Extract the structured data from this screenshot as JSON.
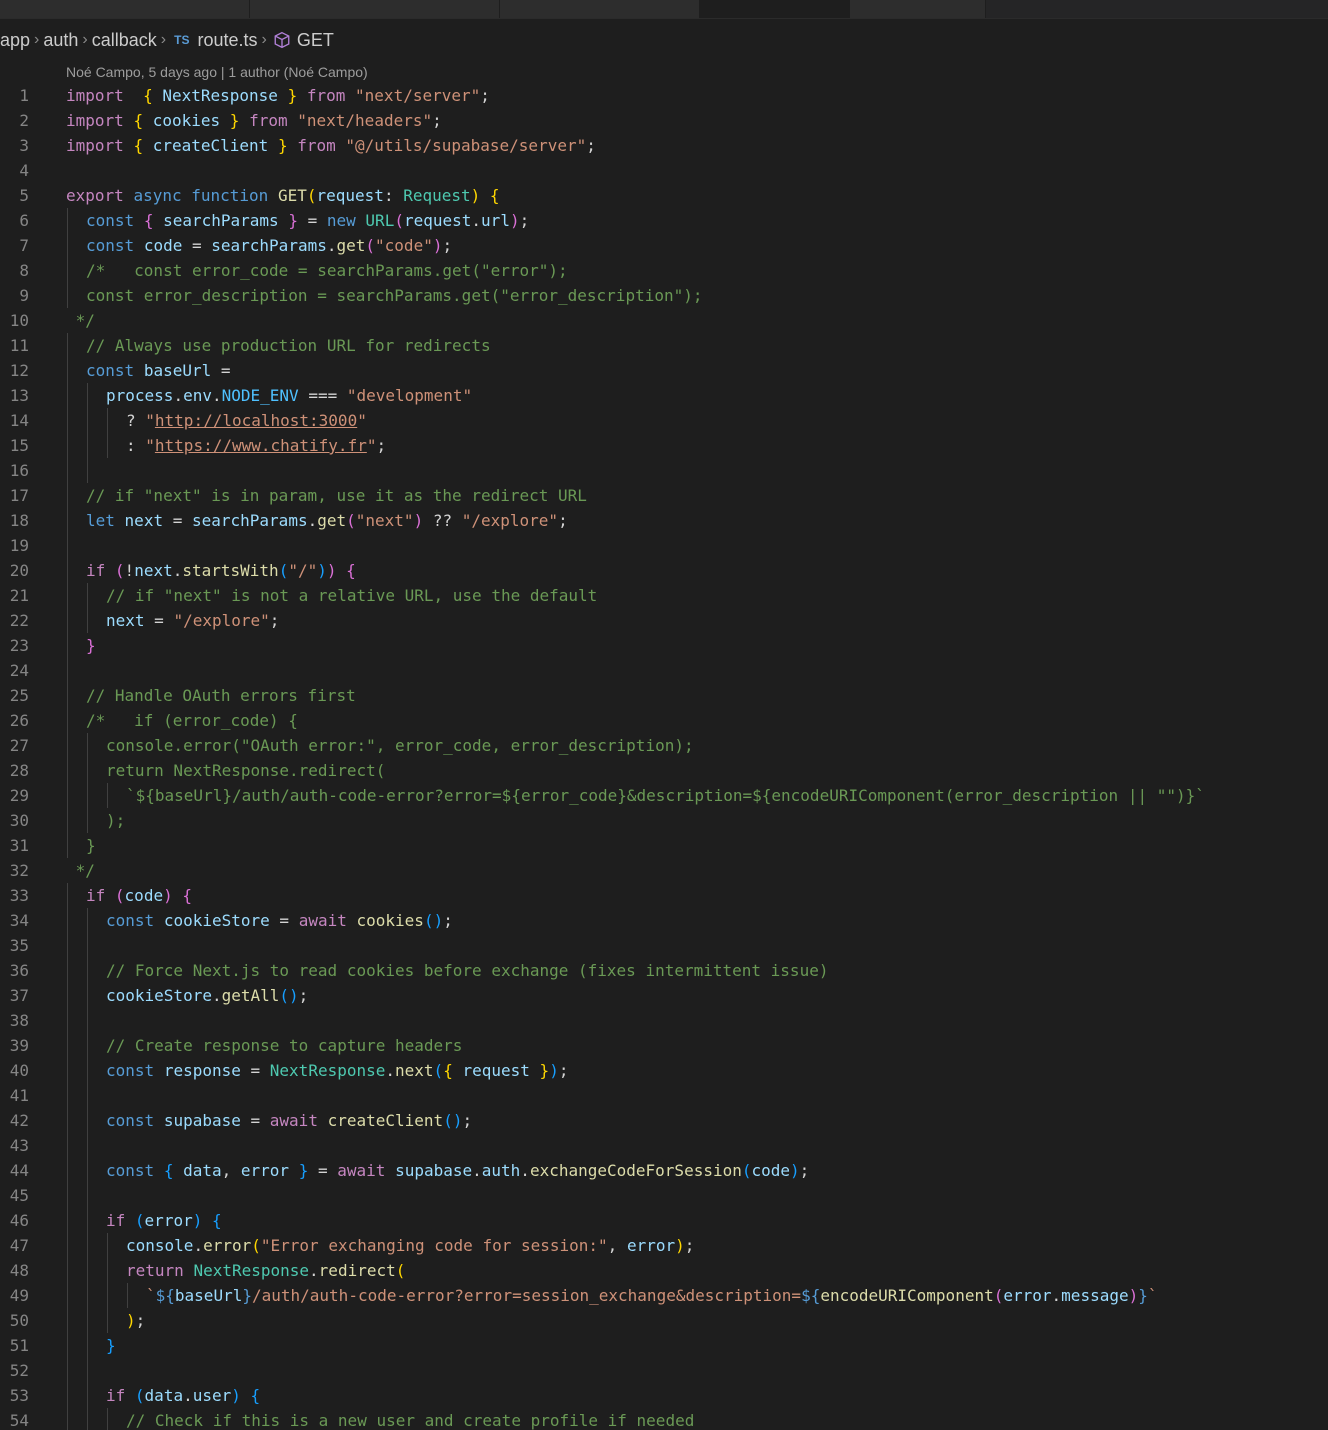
{
  "breadcrumb": {
    "items": [
      "app",
      "auth",
      "callback",
      "route.ts",
      "GET"
    ],
    "file_badge": "TS"
  },
  "blame": {
    "text": "Noé Campo, 5 days ago | 1 author (Noé Campo)"
  },
  "lines": [
    {
      "n": "1",
      "indent": 0,
      "tokens": [
        [
          "kc",
          "import"
        ],
        [
          "",
          "  "
        ],
        [
          "b1",
          "{"
        ],
        [
          "",
          " "
        ],
        [
          "var",
          "NextResponse"
        ],
        [
          "",
          " "
        ],
        [
          "b1",
          "}"
        ],
        [
          "",
          " "
        ],
        [
          "kc",
          "from"
        ],
        [
          "",
          " "
        ],
        [
          "str",
          "\"next/server\""
        ],
        [
          "",
          ";"
        ]
      ]
    },
    {
      "n": "2",
      "indent": 0,
      "tokens": [
        [
          "kc",
          "import"
        ],
        [
          "",
          " "
        ],
        [
          "b1",
          "{"
        ],
        [
          "",
          " "
        ],
        [
          "var",
          "cookies"
        ],
        [
          "",
          " "
        ],
        [
          "b1",
          "}"
        ],
        [
          "",
          " "
        ],
        [
          "kc",
          "from"
        ],
        [
          "",
          " "
        ],
        [
          "str",
          "\"next/headers\""
        ],
        [
          "",
          ";"
        ]
      ]
    },
    {
      "n": "3",
      "indent": 0,
      "tokens": [
        [
          "kc",
          "import"
        ],
        [
          "",
          " "
        ],
        [
          "b1",
          "{"
        ],
        [
          "",
          " "
        ],
        [
          "var",
          "createClient"
        ],
        [
          "",
          " "
        ],
        [
          "b1",
          "}"
        ],
        [
          "",
          " "
        ],
        [
          "kc",
          "from"
        ],
        [
          "",
          " "
        ],
        [
          "str",
          "\"@/utils/supabase/server\""
        ],
        [
          "",
          ";"
        ]
      ]
    },
    {
      "n": "4",
      "indent": 0,
      "tokens": []
    },
    {
      "n": "5",
      "indent": 0,
      "tokens": [
        [
          "kc",
          "export"
        ],
        [
          "",
          " "
        ],
        [
          "kw",
          "async"
        ],
        [
          "",
          " "
        ],
        [
          "kw",
          "function"
        ],
        [
          "",
          " "
        ],
        [
          "fn",
          "GET"
        ],
        [
          "b1",
          "("
        ],
        [
          "var",
          "request"
        ],
        [
          "",
          ": "
        ],
        [
          "type",
          "Request"
        ],
        [
          "b1",
          ")"
        ],
        [
          "",
          " "
        ],
        [
          "b1",
          "{"
        ]
      ]
    },
    {
      "n": "6",
      "indent": 1,
      "tokens": [
        [
          "kw",
          "const"
        ],
        [
          "",
          " "
        ],
        [
          "b2",
          "{"
        ],
        [
          "",
          " "
        ],
        [
          "var",
          "searchParams"
        ],
        [
          "",
          " "
        ],
        [
          "b2",
          "}"
        ],
        [
          "",
          " = "
        ],
        [
          "kw",
          "new"
        ],
        [
          "",
          " "
        ],
        [
          "type",
          "URL"
        ],
        [
          "b2",
          "("
        ],
        [
          "var",
          "request"
        ],
        [
          "",
          "."
        ],
        [
          "var",
          "url"
        ],
        [
          "b2",
          ")"
        ],
        [
          "",
          ";"
        ]
      ]
    },
    {
      "n": "7",
      "indent": 1,
      "tokens": [
        [
          "kw",
          "const"
        ],
        [
          "",
          " "
        ],
        [
          "var",
          "code"
        ],
        [
          "",
          " = "
        ],
        [
          "var",
          "searchParams"
        ],
        [
          "",
          "."
        ],
        [
          "fn",
          "get"
        ],
        [
          "b2",
          "("
        ],
        [
          "str",
          "\"code\""
        ],
        [
          "b2",
          ")"
        ],
        [
          "",
          ";"
        ]
      ]
    },
    {
      "n": "8",
      "indent": 1,
      "tokens": [
        [
          "cm",
          "/*   const error_code = searchParams.get(\"error\");"
        ]
      ]
    },
    {
      "n": "9",
      "indent": 1,
      "tokens": [
        [
          "cm",
          "const error_description = searchParams.get(\"error_description\");"
        ]
      ]
    },
    {
      "n": "10",
      "indent": 0,
      "tokens": [
        [
          "cm",
          " */"
        ]
      ]
    },
    {
      "n": "11",
      "indent": 1,
      "tokens": [
        [
          "cm",
          "// Always use production URL for redirects"
        ]
      ]
    },
    {
      "n": "12",
      "indent": 1,
      "tokens": [
        [
          "kw",
          "const"
        ],
        [
          "",
          " "
        ],
        [
          "var",
          "baseUrl"
        ],
        [
          "",
          " ="
        ]
      ]
    },
    {
      "n": "13",
      "indent": 2,
      "tokens": [
        [
          "var",
          "process"
        ],
        [
          "",
          "."
        ],
        [
          "var",
          "env"
        ],
        [
          "",
          "."
        ],
        [
          "const",
          "NODE_ENV"
        ],
        [
          "",
          " === "
        ],
        [
          "str",
          "\"development\""
        ]
      ]
    },
    {
      "n": "14",
      "indent": 3,
      "tokens": [
        [
          "",
          "? "
        ],
        [
          "str",
          "\""
        ],
        [
          "str url",
          "http://localhost:3000"
        ],
        [
          "str",
          "\""
        ]
      ]
    },
    {
      "n": "15",
      "indent": 3,
      "tokens": [
        [
          "",
          ": "
        ],
        [
          "str",
          "\""
        ],
        [
          "str url",
          "https://www.chatify.fr"
        ],
        [
          "str",
          "\""
        ],
        [
          "",
          ";"
        ]
      ]
    },
    {
      "n": "16",
      "indent": 2,
      "tokens": []
    },
    {
      "n": "17",
      "indent": 1,
      "tokens": [
        [
          "cm",
          "// if \"next\" is in param, use it as the redirect URL"
        ]
      ]
    },
    {
      "n": "18",
      "indent": 1,
      "tokens": [
        [
          "kw",
          "let"
        ],
        [
          "",
          " "
        ],
        [
          "var",
          "next"
        ],
        [
          "",
          " = "
        ],
        [
          "var",
          "searchParams"
        ],
        [
          "",
          "."
        ],
        [
          "fn",
          "get"
        ],
        [
          "b2",
          "("
        ],
        [
          "str",
          "\"next\""
        ],
        [
          "b2",
          ")"
        ],
        [
          "",
          " ?? "
        ],
        [
          "str",
          "\"/explore\""
        ],
        [
          "",
          ";"
        ]
      ]
    },
    {
      "n": "19",
      "indent": 1,
      "tokens": []
    },
    {
      "n": "20",
      "indent": 1,
      "tokens": [
        [
          "kc",
          "if"
        ],
        [
          "",
          " "
        ],
        [
          "b2",
          "("
        ],
        [
          "",
          "!"
        ],
        [
          "var",
          "next"
        ],
        [
          "",
          "."
        ],
        [
          "fn",
          "startsWith"
        ],
        [
          "b3",
          "("
        ],
        [
          "str",
          "\"/\""
        ],
        [
          "b3",
          ")"
        ],
        [
          "b2",
          ")"
        ],
        [
          "",
          " "
        ],
        [
          "b2",
          "{"
        ]
      ]
    },
    {
      "n": "21",
      "indent": 2,
      "tokens": [
        [
          "cm",
          "// if \"next\" is not a relative URL, use the default"
        ]
      ]
    },
    {
      "n": "22",
      "indent": 2,
      "tokens": [
        [
          "var",
          "next"
        ],
        [
          "",
          " = "
        ],
        [
          "str",
          "\"/explore\""
        ],
        [
          "",
          ";"
        ]
      ]
    },
    {
      "n": "23",
      "indent": 1,
      "tokens": [
        [
          "b2",
          "}"
        ]
      ]
    },
    {
      "n": "24",
      "indent": 1,
      "tokens": []
    },
    {
      "n": "25",
      "indent": 1,
      "tokens": [
        [
          "cm",
          "// Handle OAuth errors first"
        ]
      ]
    },
    {
      "n": "26",
      "indent": 1,
      "tokens": [
        [
          "cm",
          "/*   if (error_code) {"
        ]
      ]
    },
    {
      "n": "27",
      "indent": 2,
      "tokens": [
        [
          "cm",
          "console.error(\"OAuth error:\", error_code, error_description);"
        ]
      ]
    },
    {
      "n": "28",
      "indent": 2,
      "tokens": [
        [
          "cm",
          "return NextResponse.redirect("
        ]
      ]
    },
    {
      "n": "29",
      "indent": 3,
      "tokens": [
        [
          "cm",
          "`${baseUrl}/auth/auth-code-error?error=${error_code}&description=${encodeURIComponent(error_description || \"\")}`"
        ]
      ]
    },
    {
      "n": "30",
      "indent": 2,
      "tokens": [
        [
          "cm",
          ");"
        ]
      ]
    },
    {
      "n": "31",
      "indent": 1,
      "tokens": [
        [
          "cm",
          "}"
        ]
      ]
    },
    {
      "n": "32",
      "indent": 0,
      "tokens": [
        [
          "cm",
          " */"
        ]
      ]
    },
    {
      "n": "33",
      "indent": 1,
      "tokens": [
        [
          "kc",
          "if"
        ],
        [
          "",
          " "
        ],
        [
          "b2",
          "("
        ],
        [
          "var",
          "code"
        ],
        [
          "b2",
          ")"
        ],
        [
          "",
          " "
        ],
        [
          "b2",
          "{"
        ]
      ]
    },
    {
      "n": "34",
      "indent": 2,
      "tokens": [
        [
          "kw",
          "const"
        ],
        [
          "",
          " "
        ],
        [
          "var",
          "cookieStore"
        ],
        [
          "",
          " = "
        ],
        [
          "kc",
          "await"
        ],
        [
          "",
          " "
        ],
        [
          "fn",
          "cookies"
        ],
        [
          "b3",
          "()"
        ],
        [
          "",
          ";"
        ]
      ]
    },
    {
      "n": "35",
      "indent": 2,
      "tokens": []
    },
    {
      "n": "36",
      "indent": 2,
      "tokens": [
        [
          "cm",
          "// Force Next.js to read cookies before exchange (fixes intermittent issue)"
        ]
      ]
    },
    {
      "n": "37",
      "indent": 2,
      "tokens": [
        [
          "var",
          "cookieStore"
        ],
        [
          "",
          "."
        ],
        [
          "fn",
          "getAll"
        ],
        [
          "b3",
          "()"
        ],
        [
          "",
          ";"
        ]
      ]
    },
    {
      "n": "38",
      "indent": 2,
      "tokens": []
    },
    {
      "n": "39",
      "indent": 2,
      "tokens": [
        [
          "cm",
          "// Create response to capture headers"
        ]
      ]
    },
    {
      "n": "40",
      "indent": 2,
      "tokens": [
        [
          "kw",
          "const"
        ],
        [
          "",
          " "
        ],
        [
          "var",
          "response"
        ],
        [
          "",
          " = "
        ],
        [
          "type",
          "NextResponse"
        ],
        [
          "",
          "."
        ],
        [
          "fn",
          "next"
        ],
        [
          "b3",
          "("
        ],
        [
          "b1",
          "{"
        ],
        [
          "",
          " "
        ],
        [
          "var",
          "request"
        ],
        [
          "",
          " "
        ],
        [
          "b1",
          "}"
        ],
        [
          "b3",
          ")"
        ],
        [
          "",
          ";"
        ]
      ]
    },
    {
      "n": "41",
      "indent": 2,
      "tokens": []
    },
    {
      "n": "42",
      "indent": 2,
      "tokens": [
        [
          "kw",
          "const"
        ],
        [
          "",
          " "
        ],
        [
          "var",
          "supabase"
        ],
        [
          "",
          " = "
        ],
        [
          "kc",
          "await"
        ],
        [
          "",
          " "
        ],
        [
          "fn",
          "createClient"
        ],
        [
          "b3",
          "()"
        ],
        [
          "",
          ";"
        ]
      ]
    },
    {
      "n": "43",
      "indent": 2,
      "tokens": []
    },
    {
      "n": "44",
      "indent": 2,
      "tokens": [
        [
          "kw",
          "const"
        ],
        [
          "",
          " "
        ],
        [
          "b3",
          "{"
        ],
        [
          "",
          " "
        ],
        [
          "var",
          "data"
        ],
        [
          "",
          ", "
        ],
        [
          "var",
          "error"
        ],
        [
          "",
          " "
        ],
        [
          "b3",
          "}"
        ],
        [
          "",
          " = "
        ],
        [
          "kc",
          "await"
        ],
        [
          "",
          " "
        ],
        [
          "var",
          "supabase"
        ],
        [
          "",
          "."
        ],
        [
          "var",
          "auth"
        ],
        [
          "",
          "."
        ],
        [
          "fn",
          "exchangeCodeForSession"
        ],
        [
          "b3",
          "("
        ],
        [
          "var",
          "code"
        ],
        [
          "b3",
          ")"
        ],
        [
          "",
          ";"
        ]
      ]
    },
    {
      "n": "45",
      "indent": 2,
      "tokens": []
    },
    {
      "n": "46",
      "indent": 2,
      "tokens": [
        [
          "kc",
          "if"
        ],
        [
          "",
          " "
        ],
        [
          "b3",
          "("
        ],
        [
          "var",
          "error"
        ],
        [
          "b3",
          ")"
        ],
        [
          "",
          " "
        ],
        [
          "b3",
          "{"
        ]
      ]
    },
    {
      "n": "47",
      "indent": 3,
      "tokens": [
        [
          "var",
          "console"
        ],
        [
          "",
          "."
        ],
        [
          "fn",
          "error"
        ],
        [
          "b1",
          "("
        ],
        [
          "str",
          "\"Error exchanging code for session:\""
        ],
        [
          "",
          ", "
        ],
        [
          "var",
          "error"
        ],
        [
          "b1",
          ")"
        ],
        [
          "",
          ";"
        ]
      ]
    },
    {
      "n": "48",
      "indent": 3,
      "tokens": [
        [
          "kc",
          "return"
        ],
        [
          "",
          " "
        ],
        [
          "type",
          "NextResponse"
        ],
        [
          "",
          "."
        ],
        [
          "fn",
          "redirect"
        ],
        [
          "b1",
          "("
        ]
      ]
    },
    {
      "n": "49",
      "indent": 4,
      "tokens": [
        [
          "str",
          "`"
        ],
        [
          "kw",
          "${"
        ],
        [
          "var",
          "baseUrl"
        ],
        [
          "kw",
          "}"
        ],
        [
          "str",
          "/auth/auth-code-error?error=session_exchange&description="
        ],
        [
          "kw",
          "${"
        ],
        [
          "fn",
          "encodeURIComponent"
        ],
        [
          "b2",
          "("
        ],
        [
          "var",
          "error"
        ],
        [
          "",
          "."
        ],
        [
          "var",
          "message"
        ],
        [
          "b2",
          ")"
        ],
        [
          "kw",
          "}"
        ],
        [
          "str",
          "`"
        ]
      ]
    },
    {
      "n": "50",
      "indent": 3,
      "tokens": [
        [
          "b1",
          ")"
        ],
        [
          "",
          ";"
        ]
      ]
    },
    {
      "n": "51",
      "indent": 2,
      "tokens": [
        [
          "b3",
          "}"
        ]
      ]
    },
    {
      "n": "52",
      "indent": 2,
      "tokens": []
    },
    {
      "n": "53",
      "indent": 2,
      "tokens": [
        [
          "kc",
          "if"
        ],
        [
          "",
          " "
        ],
        [
          "b3",
          "("
        ],
        [
          "var",
          "data"
        ],
        [
          "",
          "."
        ],
        [
          "var",
          "user"
        ],
        [
          "b3",
          ")"
        ],
        [
          "",
          " "
        ],
        [
          "b3",
          "{"
        ]
      ]
    },
    {
      "n": "54",
      "indent": 3,
      "tokens": [
        [
          "cm",
          "// Check if this is a new user and create profile if needed"
        ]
      ]
    }
  ]
}
